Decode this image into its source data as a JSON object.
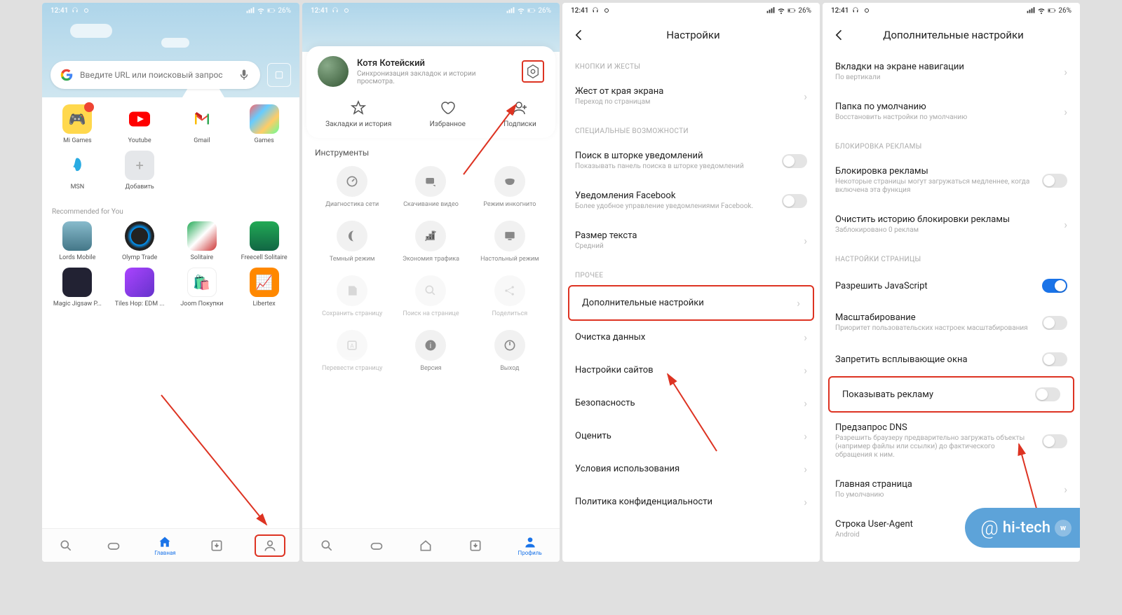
{
  "status": {
    "time": "12:41",
    "battery": "26%"
  },
  "p1": {
    "search_placeholder": "Введите URL или поисковый запрос",
    "apps_top": [
      {
        "label": "Mi Games",
        "color": "#ffd84d"
      },
      {
        "label": "Youtube",
        "color": "#fff"
      },
      {
        "label": "Gmail",
        "color": "#fff"
      },
      {
        "label": "Games",
        "color": "linear"
      },
      {
        "label": "MSN",
        "color": "#fff"
      },
      {
        "label": "Добавить",
        "color": "#e5e7ea"
      }
    ],
    "rec_title": "Recommended for You",
    "apps_rec": [
      {
        "label": "Lords Mobile"
      },
      {
        "label": "Olymp Trade"
      },
      {
        "label": "Solitaire"
      },
      {
        "label": "Freecell Solitaire"
      },
      {
        "label": "Magic Jigsaw P..."
      },
      {
        "label": "Tiles Hop: EDM ..."
      },
      {
        "label": "Joom Покупки"
      },
      {
        "label": "Libertex"
      }
    ],
    "nav": [
      "",
      "",
      "Главная",
      "",
      ""
    ]
  },
  "p2": {
    "profile_name": "Котя Котейский",
    "profile_sub": "Синхронизация закладок и истории просмотра.",
    "actions": [
      {
        "label": "Закладки и история"
      },
      {
        "label": "Избранное"
      },
      {
        "label": "Подписки"
      }
    ],
    "tools_title": "Инструменты",
    "tools": [
      {
        "label": "Диагностика сети"
      },
      {
        "label": "Скачивание видео"
      },
      {
        "label": "Режим инкогнито"
      },
      {
        "label": "Темный режим"
      },
      {
        "label": "Экономия трафика"
      },
      {
        "label": "Настольный режим"
      },
      {
        "label": "Сохранить страницу",
        "dim": true
      },
      {
        "label": "Поиск на странице",
        "dim": true
      },
      {
        "label": "Поделиться",
        "dim": true
      },
      {
        "label": "Перевести страницу",
        "dim": true
      },
      {
        "label": "Версия"
      },
      {
        "label": "Выход"
      }
    ],
    "nav_label": "Профиль"
  },
  "p3": {
    "title": "Настройки",
    "sec1": "КНОПКИ И ЖЕСТЫ",
    "r1": {
      "t": "Жест от края экрана",
      "s": "Переход по страницам"
    },
    "sec2": "СПЕЦИАЛЬНЫЕ ВОЗМОЖНОСТИ",
    "r2": {
      "t": "Поиск в шторке уведомлений",
      "s": "Показывать панель поиска в шторке уведомлений"
    },
    "r3": {
      "t": "Уведомления Facebook",
      "s": "Более удобное управление уведомлениями Facebook."
    },
    "r4": {
      "t": "Размер текста",
      "s": "Средний"
    },
    "sec3": "ПРОЧЕЕ",
    "r5": {
      "t": "Дополнительные настройки"
    },
    "r6": {
      "t": "Очистка данных"
    },
    "r7": {
      "t": "Настройки сайтов"
    },
    "r8": {
      "t": "Безопасность"
    },
    "r9": {
      "t": "Оценить"
    },
    "r10": {
      "t": "Условия использования"
    },
    "r11": {
      "t": "Политика конфиденциальности"
    }
  },
  "p4": {
    "title": "Дополнительные настройки",
    "r1": {
      "t": "Вкладки на экране навигации",
      "s": "По вертикали"
    },
    "r2": {
      "t": "Папка по умолчанию",
      "s": "Восстановить настройки по умолчанию"
    },
    "sec2": "БЛОКИРОВКА РЕКЛАМЫ",
    "r3": {
      "t": "Блокировка рекламы",
      "s": "Некоторые страницы могут загружаться медленнее, когда включена эта функция"
    },
    "r4": {
      "t": "Очистить историю блокировки рекламы",
      "s": "Заблокировано 0 реклам"
    },
    "sec3": "НАСТРОЙКИ СТРАНИЦЫ",
    "r5": {
      "t": "Разрешить JavaScript"
    },
    "r6": {
      "t": "Масштабирование",
      "s": "Приоритет пользовательских настроек масштабирования"
    },
    "r7": {
      "t": "Запретить всплывающие окна"
    },
    "r8": {
      "t": "Показывать рекламу"
    },
    "r9": {
      "t": "Предзапрос DNS",
      "s": "Разрешить браузеру предварительно загружать объекты (например файлы или ссылки) до фактического обращения к ним."
    },
    "r10": {
      "t": "Главная страница",
      "s": "По умолчанию"
    },
    "r11": {
      "t": "Строка User-Agent",
      "s": "Android"
    }
  },
  "watermark": "hi-tech"
}
